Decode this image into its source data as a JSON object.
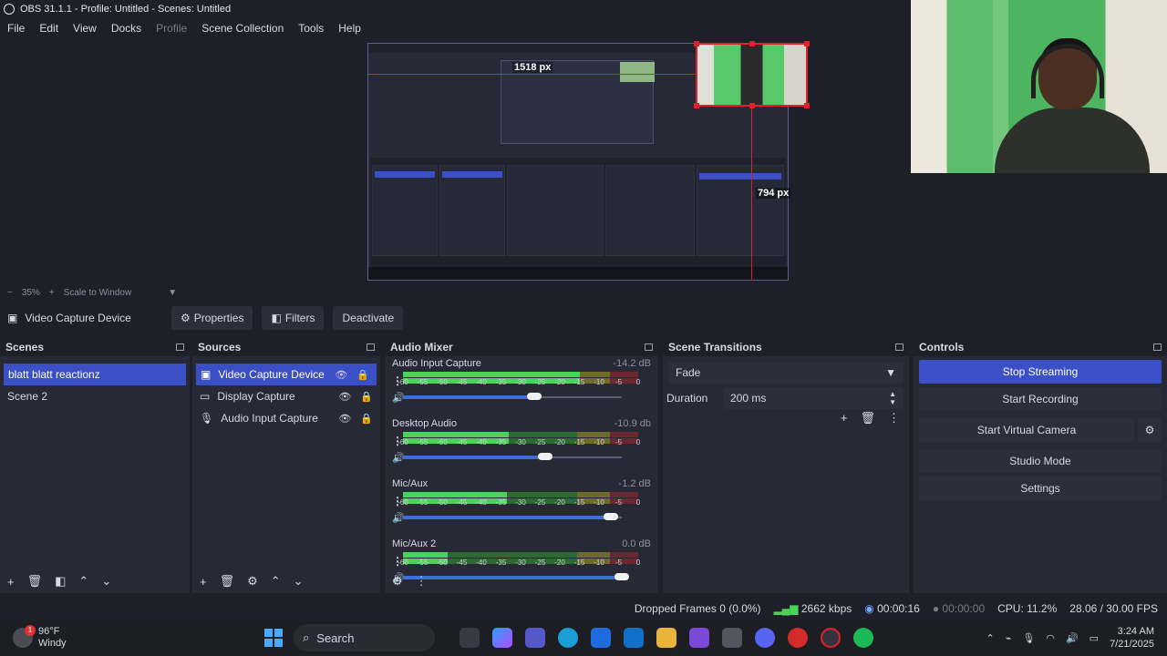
{
  "window": {
    "title": "OBS 31.1.1 - Profile: Untitled - Scenes: Untitled"
  },
  "menu": [
    "File",
    "Edit",
    "View",
    "Docks",
    "Profile",
    "Scene Collection",
    "Tools",
    "Help"
  ],
  "preview": {
    "width_label": "1518 px",
    "height_label": "794 px",
    "zoom": "35%",
    "scale_mode": "Scale to Window"
  },
  "source_toolbar": {
    "selected_source": "Video Capture Device",
    "properties": "Properties",
    "filters": "Filters",
    "deactivate": "Deactivate"
  },
  "scenes": {
    "title": "Scenes",
    "items": [
      "blatt blatt reactionz",
      "Scene 2"
    ]
  },
  "sources": {
    "title": "Sources",
    "items": [
      "Video Capture Device",
      "Display Capture",
      "Audio Input Capture"
    ]
  },
  "mixer": {
    "title": "Audio Mixer",
    "ticks": [
      "-60",
      "-55",
      "-50",
      "-45",
      "-40",
      "-35",
      "-30",
      "-25",
      "-20",
      "-15",
      "-10",
      "-5",
      "0"
    ],
    "channels": [
      {
        "name": "Audio Input Capture",
        "db": "-14.2 dB",
        "level": 0.75,
        "volume": 0.6
      },
      {
        "name": "Desktop Audio",
        "db": "-10.9 db",
        "level": 0.45,
        "volume": 0.65
      },
      {
        "name": "Mic/Aux",
        "db": "-1.2 dB",
        "level": 0.44,
        "volume": 0.95
      },
      {
        "name": "Mic/Aux 2",
        "db": "0.0 dB",
        "level": 0.19,
        "volume": 1.0
      }
    ]
  },
  "transitions": {
    "title": "Scene Transitions",
    "selected": "Fade",
    "duration_label": "Duration",
    "duration_value": "200 ms"
  },
  "controls": {
    "title": "Controls",
    "buttons": [
      "Stop Streaming",
      "Start Recording",
      "Start Virtual Camera",
      "Studio Mode",
      "Settings"
    ]
  },
  "status": {
    "dropped": "Dropped Frames 0 (0.0%)",
    "bitrate": "2662 kbps",
    "stream_time": "00:00:16",
    "rec_time": "00:00:00",
    "cpu": "CPU: 11.2%",
    "fps": "28.06 / 30.00 FPS"
  },
  "taskbar": {
    "temp": "96°F",
    "weather": "Windy",
    "badge": "1",
    "search": "Search",
    "time": "3:24 AM",
    "date": "7/21/2025"
  },
  "colors": {
    "accent": "#3b4fc6",
    "selection_red": "#e0202a",
    "meter_green": "#4ad25a"
  }
}
